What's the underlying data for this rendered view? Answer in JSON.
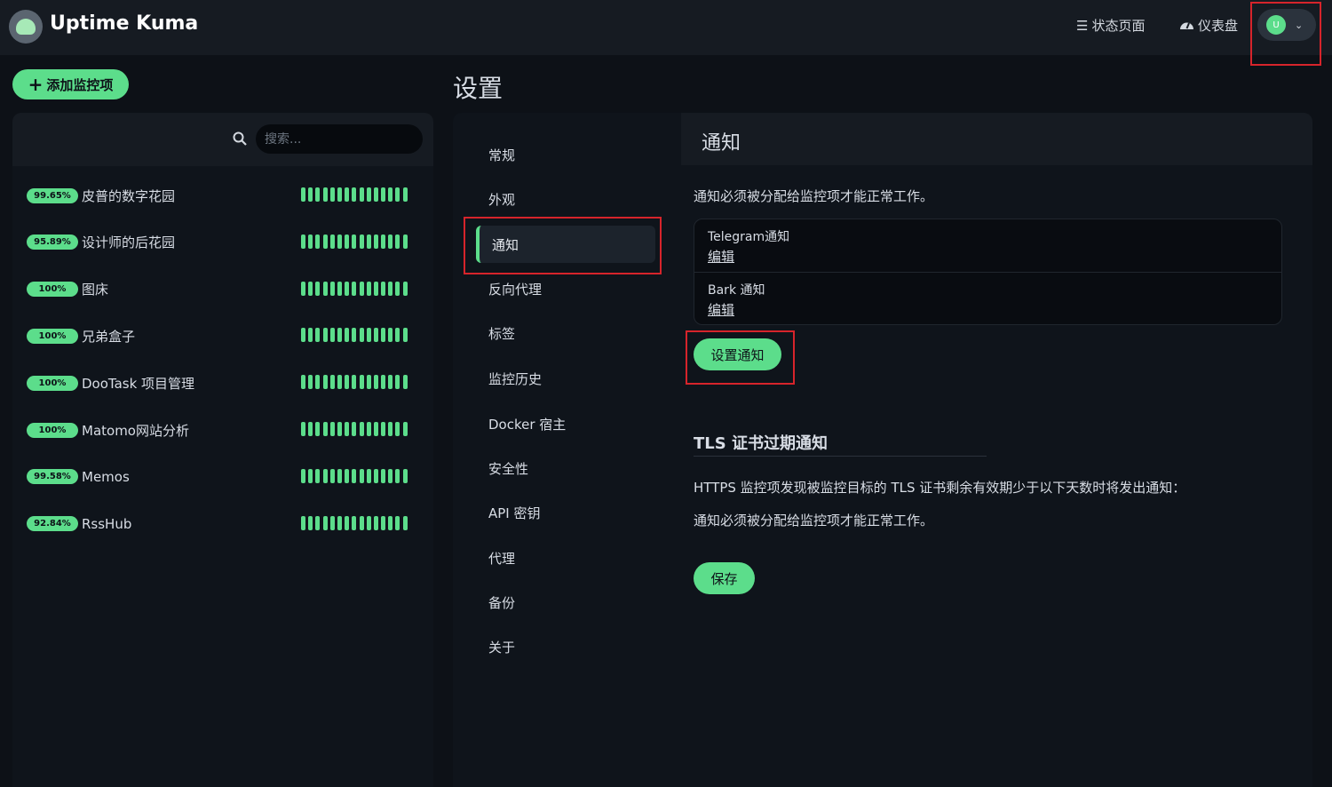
{
  "app": {
    "title": "Uptime Kuma"
  },
  "header": {
    "status_page": "状态页面",
    "dashboard": "仪表盘",
    "avatar_letter": "U",
    "status_icon": "list-icon",
    "dashboard_icon": "gauge-icon"
  },
  "sidebar": {
    "add_button": "添加监控项",
    "search_placeholder": "搜索...",
    "monitors": [
      {
        "uptime": "99.65%",
        "name": "皮普的数字花园"
      },
      {
        "uptime": "95.89%",
        "name": "设计师的后花园"
      },
      {
        "uptime": "100%",
        "name": "图床"
      },
      {
        "uptime": "100%",
        "name": "兄弟盒子"
      },
      {
        "uptime": "100%",
        "name": "DooTask 项目管理"
      },
      {
        "uptime": "100%",
        "name": "Matomo网站分析"
      },
      {
        "uptime": "99.58%",
        "name": "Memos"
      },
      {
        "uptime": "92.84%",
        "name": "RssHub"
      }
    ]
  },
  "settings": {
    "title": "设置",
    "menu": [
      "常规",
      "外观",
      "通知",
      "反向代理",
      "标签",
      "监控历史",
      "Docker 宿主",
      "安全性",
      "API 密钥",
      "代理",
      "备份",
      "关于"
    ],
    "active_index": 2
  },
  "content": {
    "title": "通知",
    "intro": "通知必须被分配给监控项才能正常工作。",
    "notifications": [
      {
        "name": "Telegram通知",
        "edit": "编辑"
      },
      {
        "name": "Bark 通知",
        "edit": "编辑"
      }
    ],
    "setup_button": "设置通知",
    "tls_title": "TLS 证书过期通知",
    "tls_desc": "HTTPS 监控项发现被监控目标的 TLS 证书剩余有效期少于以下天数时将发出通知：",
    "tls_note": "通知必须被分配给监控项才能正常工作。",
    "save_button": "保存"
  },
  "colors": {
    "accent": "#5cdd8b",
    "highlight": "#d6242b",
    "background": "#0d1117"
  }
}
